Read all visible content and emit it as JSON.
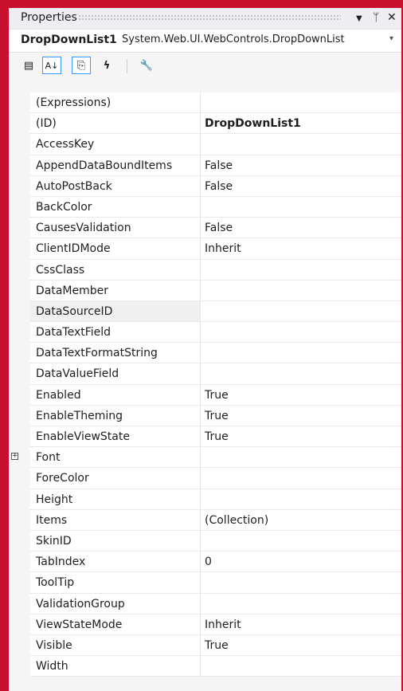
{
  "title": "Properties",
  "title_buttons": {
    "dropdown": "▼",
    "pin": "ᛘ",
    "close": "✕"
  },
  "object_selector": {
    "name": "DropDownList1",
    "type": "System.Web.UI.WebControls.DropDownList",
    "dropdown_glyph": "▾"
  },
  "toolbar": {
    "categorized": "▤",
    "alphabetical": "A↓",
    "properties": "⎘",
    "events": "ϟ",
    "property_pages": "🔧"
  },
  "properties": [
    {
      "name": "(Expressions)",
      "value": ""
    },
    {
      "name": "(ID)",
      "value": "DropDownList1"
    },
    {
      "name": "AccessKey",
      "value": ""
    },
    {
      "name": "AppendDataBoundItems",
      "value": "False"
    },
    {
      "name": "AutoPostBack",
      "value": "False"
    },
    {
      "name": "BackColor",
      "value": ""
    },
    {
      "name": "CausesValidation",
      "value": "False"
    },
    {
      "name": "ClientIDMode",
      "value": "Inherit"
    },
    {
      "name": "CssClass",
      "value": ""
    },
    {
      "name": "DataMember",
      "value": ""
    },
    {
      "name": "DataSourceID",
      "value": ""
    },
    {
      "name": "DataTextField",
      "value": ""
    },
    {
      "name": "DataTextFormatString",
      "value": ""
    },
    {
      "name": "DataValueField",
      "value": ""
    },
    {
      "name": "Enabled",
      "value": "True"
    },
    {
      "name": "EnableTheming",
      "value": "True"
    },
    {
      "name": "EnableViewState",
      "value": "True"
    },
    {
      "name": "Font",
      "value": "",
      "expander": "+"
    },
    {
      "name": "ForeColor",
      "value": ""
    },
    {
      "name": "Height",
      "value": ""
    },
    {
      "name": "Items",
      "value": "(Collection)"
    },
    {
      "name": "SkinID",
      "value": ""
    },
    {
      "name": "TabIndex",
      "value": "0"
    },
    {
      "name": "ToolTip",
      "value": ""
    },
    {
      "name": "ValidationGroup",
      "value": ""
    },
    {
      "name": "ViewStateMode",
      "value": "Inherit"
    },
    {
      "name": "Visible",
      "value": "True"
    },
    {
      "name": "Width",
      "value": ""
    }
  ],
  "colors": {
    "frame": "#c8102e",
    "background": "#f5f5f5",
    "selection_border": "#3399ff"
  }
}
